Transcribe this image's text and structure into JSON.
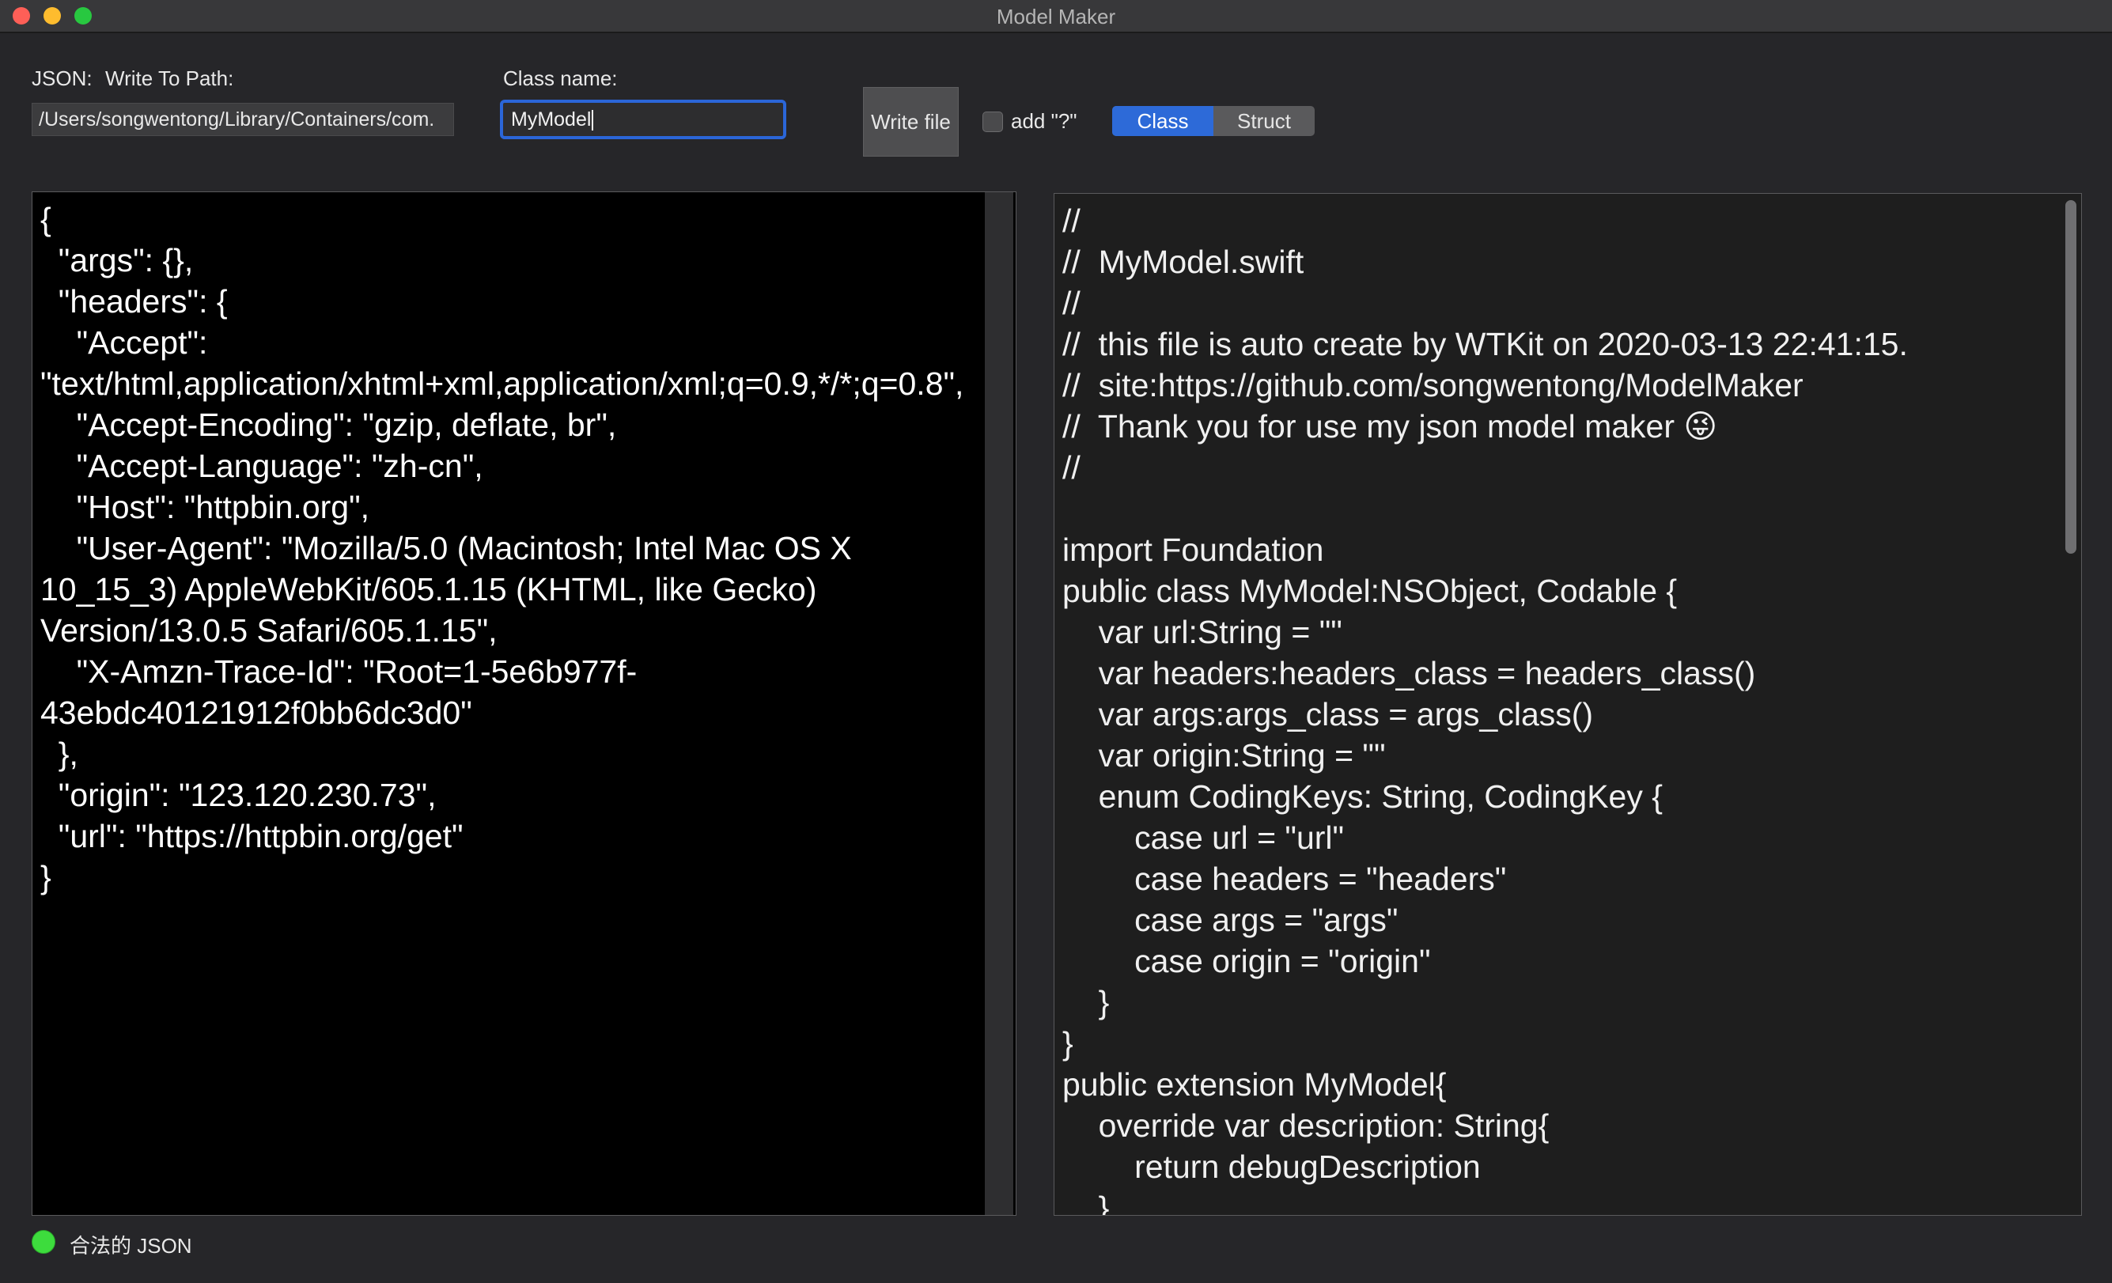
{
  "window": {
    "title": "Model Maker"
  },
  "toolbar": {
    "json_label": "JSON:",
    "write_path_label": "Write To Path:",
    "path_value": "/Users/songwentong/Library/Containers/com.",
    "class_name_label": "Class name:",
    "class_name_value": "MyModel",
    "write_file_label": "Write file",
    "add_optional_label": "add \"?\"",
    "add_optional_checked": false,
    "segment": {
      "items": [
        "Class",
        "Struct"
      ],
      "selected": "Class"
    }
  },
  "json_input": {
    "text": "{\n  \"args\": {},\n  \"headers\": {\n    \"Accept\": \"text/html,application/xhtml+xml,application/xml;q=0.9,*/*;q=0.8\",\n    \"Accept-Encoding\": \"gzip, deflate, br\",\n    \"Accept-Language\": \"zh-cn\",\n    \"Host\": \"httpbin.org\",\n    \"User-Agent\": \"Mozilla/5.0 (Macintosh; Intel Mac OS X 10_15_3) AppleWebKit/605.1.15 (KHTML, like Gecko) Version/13.0.5 Safari/605.1.15\",\n    \"X-Amzn-Trace-Id\": \"Root=1-5e6b977f-43ebdc40121912f0bb6dc3d0\"\n  },\n  \"origin\": \"123.120.230.73\",\n  \"url\": \"https://httpbin.org/get\"\n}"
  },
  "swift_output": {
    "text": "//\n//  MyModel.swift\n//\n//  this file is auto create by WTKit on 2020-03-13 22:41:15.\n//  site:https://github.com/songwentong/ModelMaker\n//  Thank you for use my json model maker 😜\n//\n\nimport Foundation\npublic class MyModel:NSObject, Codable {\n    var url:String = \"\"\n    var headers:headers_class = headers_class()\n    var args:args_class = args_class()\n    var origin:String = \"\"\n    enum CodingKeys: String, CodingKey {\n        case url = \"url\"\n        case headers = \"headers\"\n        case args = \"args\"\n        case origin = \"origin\"\n    }\n}\npublic extension MyModel{\n    override var description: String{\n        return debugDescription\n    }"
  },
  "status": {
    "text": "合法的 JSON",
    "color": "#3ddc3d"
  }
}
